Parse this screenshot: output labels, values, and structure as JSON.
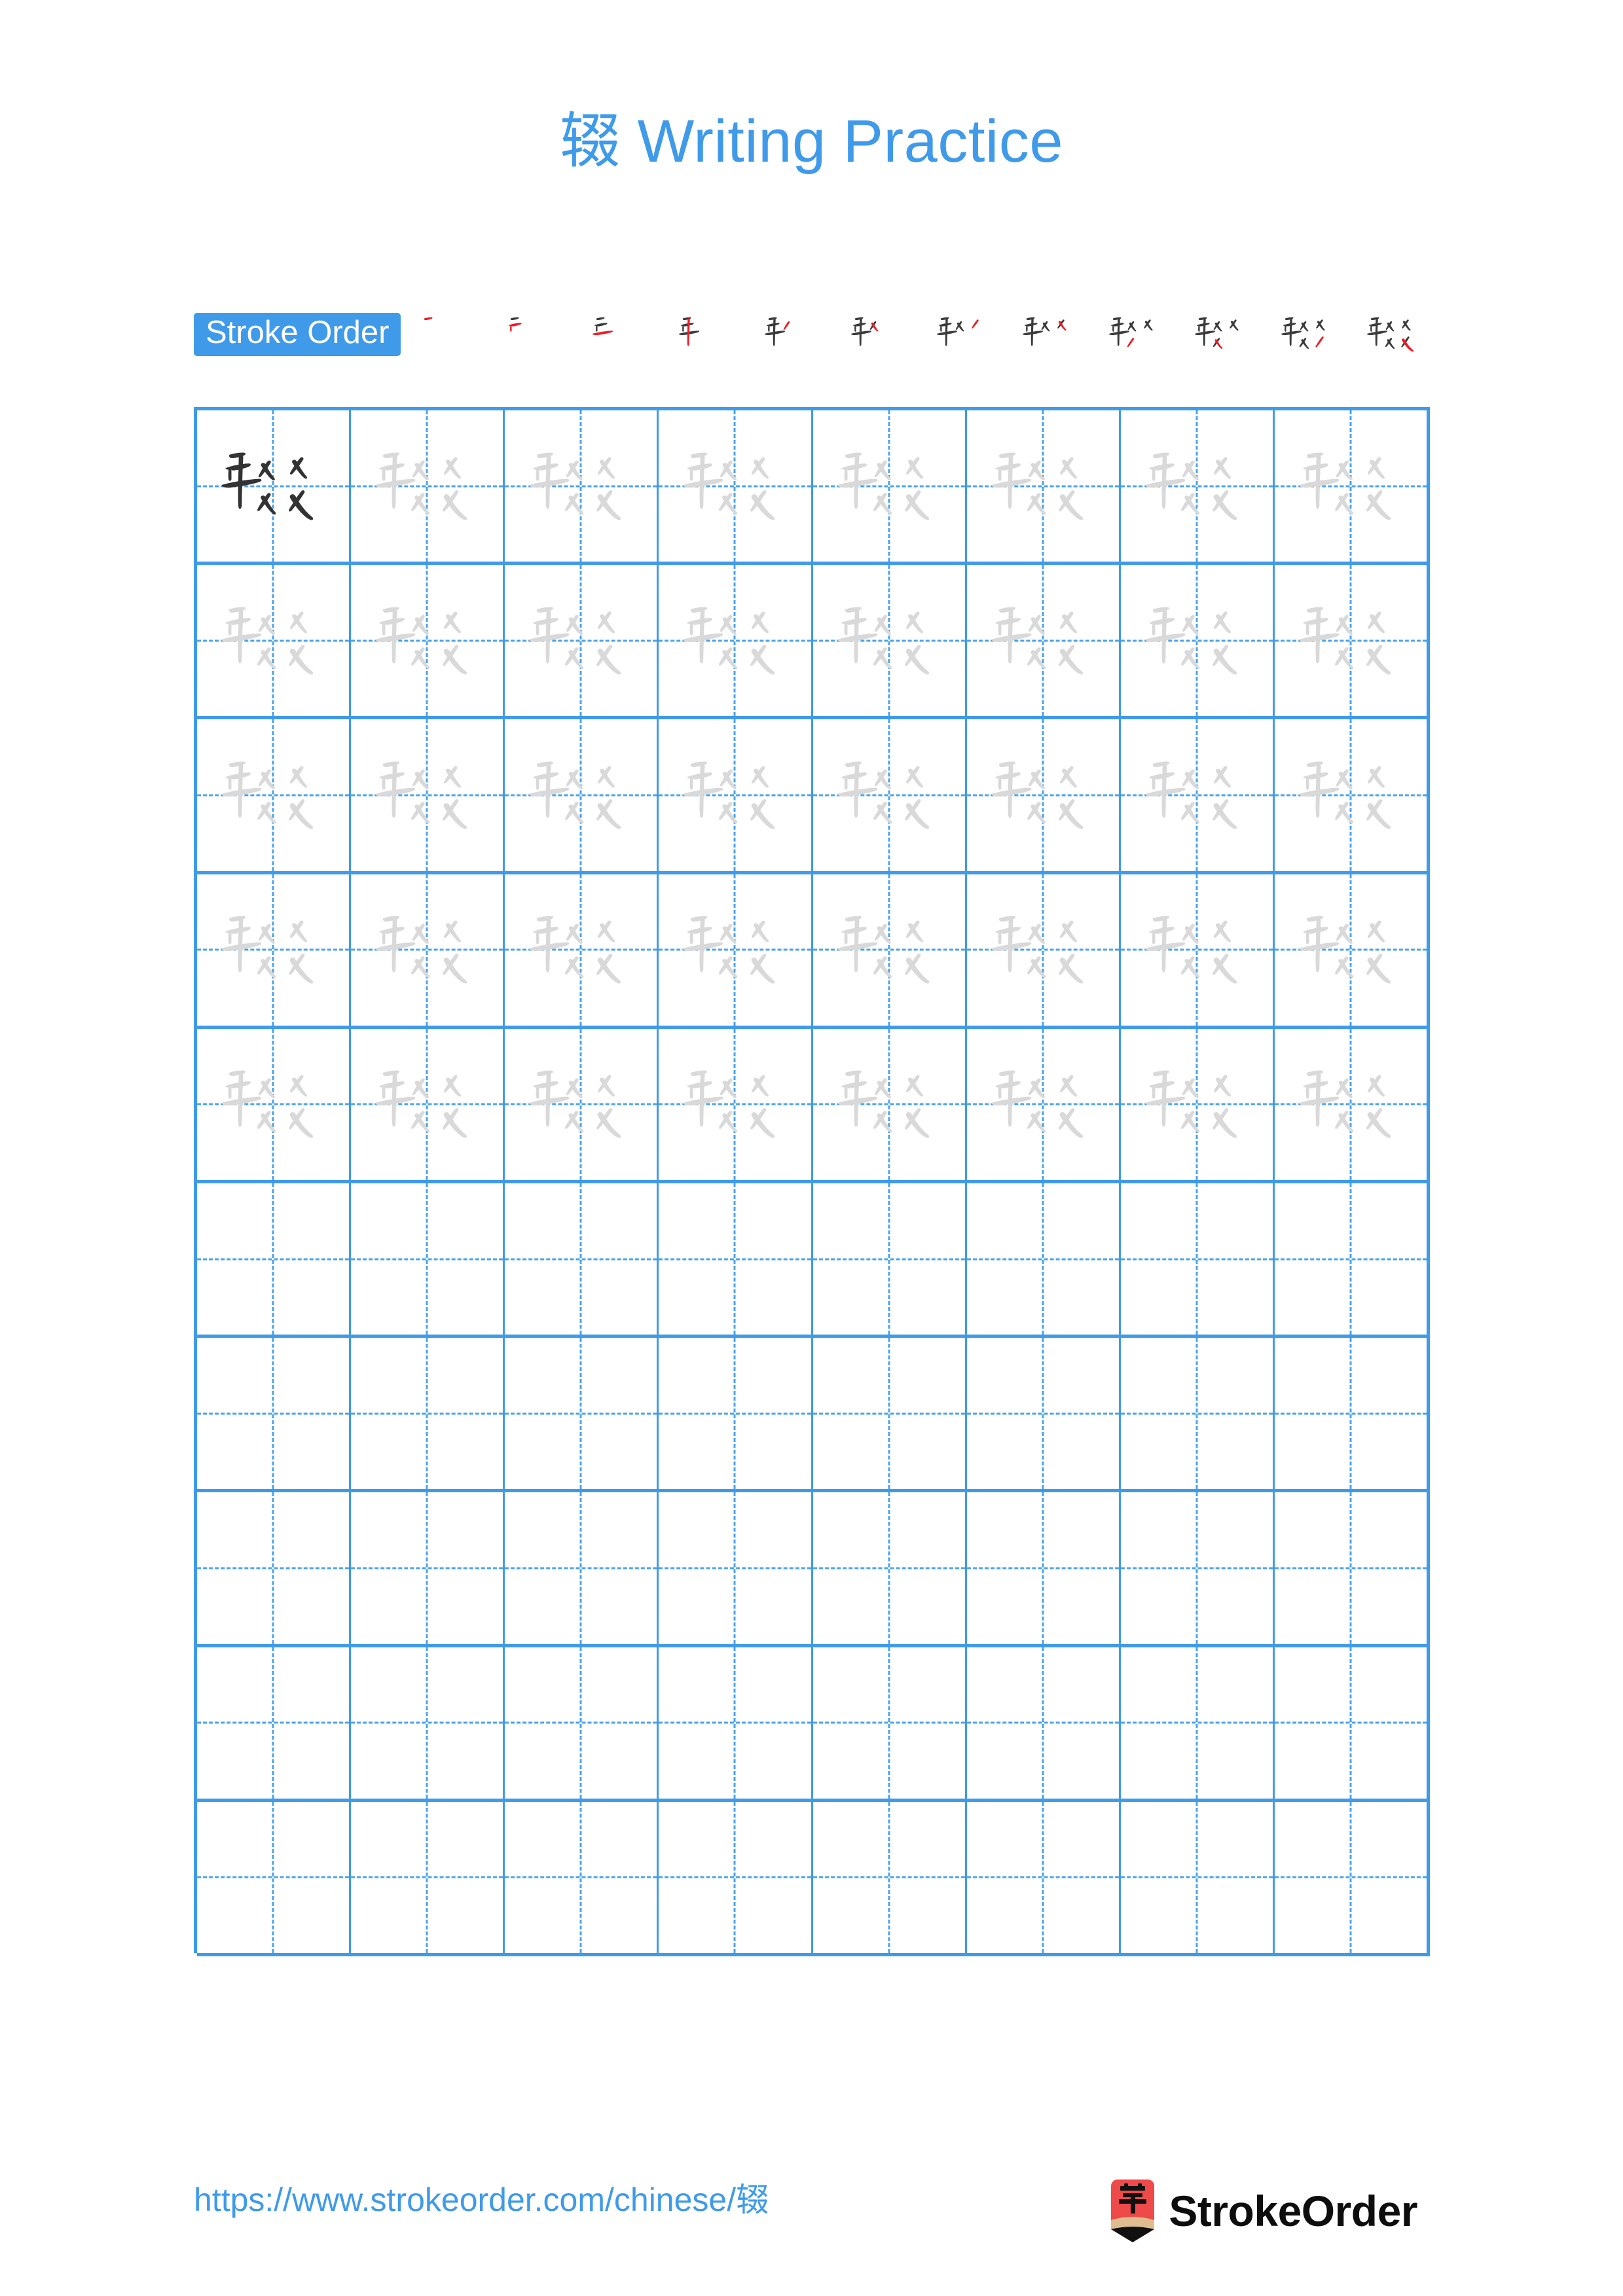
{
  "page": {
    "character": "辍",
    "title_suffix": " Writing Practice",
    "title_full": "辍 Writing Practice",
    "accent_color": "#3f9ae9",
    "grid_line_color": "#3f9ae9",
    "traced_char_color": "#d9d9d9",
    "model_char_color": "#333333",
    "new_stroke_color": "#ee1c25",
    "background": "#ffffff"
  },
  "stroke_order": {
    "label": "Stroke Order",
    "total_strokes": 12,
    "steps": [
      1,
      2,
      3,
      4,
      5,
      6,
      7,
      8,
      9,
      10,
      11,
      12
    ]
  },
  "practice_grid": {
    "columns": 8,
    "rows": 10,
    "filled_rows": 5,
    "empty_rows": 5,
    "model_cell": {
      "row": 1,
      "column": 1
    },
    "cell_character": "辍"
  },
  "footer": {
    "url": "https://www.strokeorder.com/chinese/辍",
    "brand_name": "StrokeOrder",
    "logo": {
      "icon_name": "pencil-logo-icon",
      "character": "字",
      "body_color": "#ef4a4a",
      "wood_color": "#e0bd91",
      "tip_color": "#111111"
    }
  }
}
